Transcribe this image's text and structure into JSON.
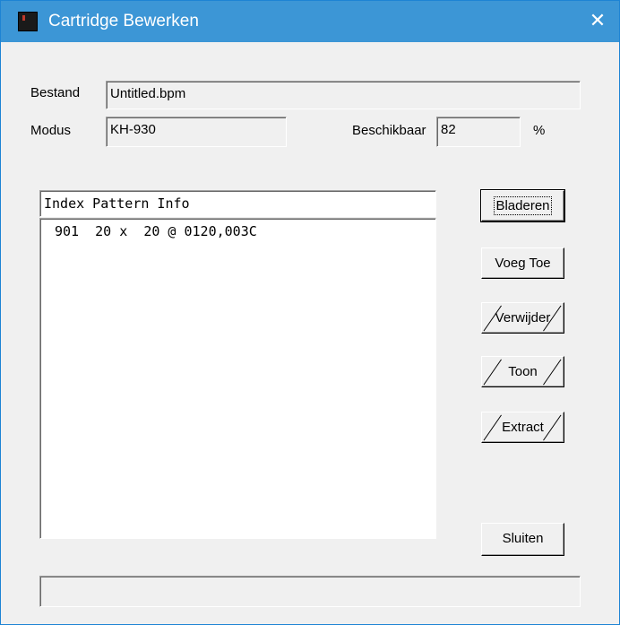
{
  "window": {
    "title": "Cartridge Bewerken",
    "close_glyph": "✕",
    "icon": "cartridge-app-icon"
  },
  "form": {
    "bestand_label": "Bestand",
    "bestand_value": "Untitled.bpm",
    "modus_label": "Modus",
    "modus_value": "KH-930",
    "beschikbaar_label": "Beschikbaar",
    "beschikbaar_value": "82",
    "percent_label": "%"
  },
  "list": {
    "header": "Index Pattern Info",
    "items": [
      "901  20 x  20 @ 0120,003C"
    ]
  },
  "buttons": {
    "bladeren": "Bladeren",
    "voeg_toe": "Voeg Toe",
    "verwijder": "Verwijder",
    "toon": "Toon",
    "extract": "Extract",
    "sluiten": "Sluiten"
  },
  "status": {
    "text": ""
  }
}
